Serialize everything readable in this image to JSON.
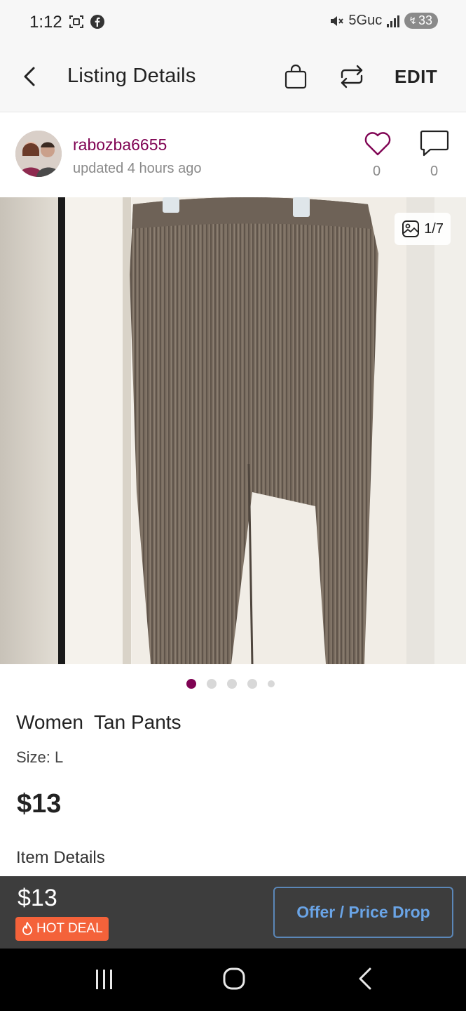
{
  "status_bar": {
    "time": "1:12",
    "network": "5Guc",
    "battery": "33"
  },
  "header": {
    "title": "Listing Details",
    "edit_label": "EDIT"
  },
  "seller": {
    "username": "rabozba6655",
    "updated": "updated 4 hours ago",
    "likes": "0",
    "comments": "0"
  },
  "photo": {
    "counter": "1/7",
    "dots_total": 5,
    "dots_active_index": 0
  },
  "listing": {
    "title": "Women  Tan Pants",
    "size": "Size: L",
    "price": "$13",
    "details_heading": "Item Details"
  },
  "bottom_bar": {
    "price": "$13",
    "badge": "HOT DEAL",
    "offer_button": "Offer / Price Drop"
  },
  "colors": {
    "brand": "#7f0353",
    "hot_deal": "#f4623a",
    "offer_button_text": "#6aa4e6",
    "bottom_bar_bg": "#3d3d3d"
  },
  "icons": {
    "status_left": [
      "screenshot-icon",
      "facebook-icon"
    ],
    "status_right": [
      "mute-icon",
      "signal-icon",
      "battery-icon"
    ],
    "header": [
      "back-icon",
      "shopping-bag-icon",
      "share-icon"
    ],
    "seller": [
      "heart-icon",
      "comment-icon"
    ],
    "photo_counter": "gallery-icon",
    "badge": "fire-icon",
    "nav": [
      "recent-apps-icon",
      "home-icon",
      "back-nav-icon"
    ]
  }
}
